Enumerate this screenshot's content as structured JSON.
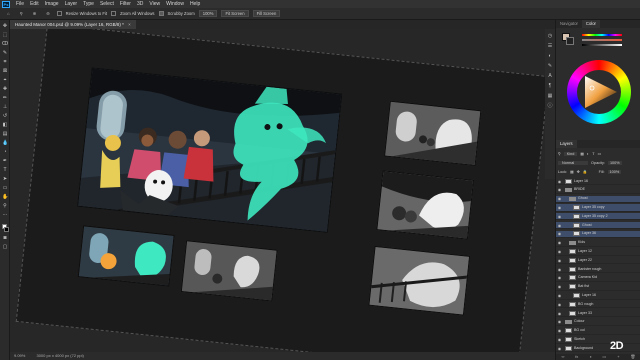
{
  "menubar": {
    "app_icon": "Ps",
    "items": [
      "File",
      "Edit",
      "Image",
      "Layer",
      "Type",
      "Select",
      "Filter",
      "3D",
      "View",
      "Window",
      "Help"
    ]
  },
  "optionsbar": {
    "resize_windows": "Resize Windows to Fit",
    "zoom_all": "Zoom All Windows",
    "scrubby_zoom": "Scrubby Zoom",
    "zoom_pct": "100%",
    "fit_screen": "Fit Screen",
    "fill_screen": "Fill Screen"
  },
  "document": {
    "tab_title": "Haunted Manor 004.psd @ 9.09% (Layer 16, RGB/8) *"
  },
  "statusbar": {
    "zoom": "9.09%",
    "doc_info": "3000 px x 4000 px (72 ppi)"
  },
  "panels": {
    "color_tabs": [
      "Navigator",
      "Color"
    ],
    "layers_tabs": [
      "Layers"
    ],
    "kind_label": "Kind",
    "blend_mode": "Normal",
    "opacity_label": "Opacity:",
    "opacity_value": "100%",
    "lock_label": "Lock:",
    "fill_label": "Fill:",
    "fill_value": "100%",
    "layers": [
      {
        "name": "Layer 16",
        "type": "layer",
        "indent": 0,
        "selected": false
      },
      {
        "name": "BRIDE",
        "type": "group",
        "indent": 0,
        "selected": false
      },
      {
        "name": "Ghost",
        "type": "group",
        "indent": 1,
        "selected": true
      },
      {
        "name": "Layer 35 copy",
        "type": "layer",
        "indent": 2,
        "selected": true
      },
      {
        "name": "Layer 35 copy 2",
        "type": "layer",
        "indent": 2,
        "selected": true
      },
      {
        "name": "Ghost",
        "type": "layer",
        "indent": 2,
        "selected": true
      },
      {
        "name": "Layer 36",
        "type": "layer",
        "indent": 2,
        "selected": true
      },
      {
        "name": "Kids",
        "type": "group",
        "indent": 1,
        "selected": false
      },
      {
        "name": "Layer 12",
        "type": "layer",
        "indent": 1,
        "selected": false
      },
      {
        "name": "Layer 22",
        "type": "layer",
        "indent": 1,
        "selected": false
      },
      {
        "name": "Banister rough",
        "type": "layer",
        "indent": 1,
        "selected": false
      },
      {
        "name": "Camera Kid",
        "type": "layer",
        "indent": 1,
        "selected": false
      },
      {
        "name": "Bat fist",
        "type": "layer",
        "indent": 1,
        "selected": false
      },
      {
        "name": "Layer 16",
        "type": "layer",
        "indent": 2,
        "selected": false
      },
      {
        "name": "BG rough",
        "type": "layer",
        "indent": 1,
        "selected": false
      },
      {
        "name": "Layer 33",
        "type": "layer",
        "indent": 1,
        "selected": false
      },
      {
        "name": "Colour",
        "type": "group",
        "indent": 0,
        "selected": false
      },
      {
        "name": "BG col",
        "type": "layer",
        "indent": 0,
        "selected": false
      },
      {
        "name": "Sketch",
        "type": "layer",
        "indent": 0,
        "selected": false
      },
      {
        "name": "Background",
        "type": "layer",
        "indent": 0,
        "selected": false
      }
    ]
  },
  "watermark": "2D",
  "colors": {
    "accent_ghost": "#3ee8c0",
    "panel_bg": "#2c2c2c",
    "selection": "#3d4d6a"
  }
}
